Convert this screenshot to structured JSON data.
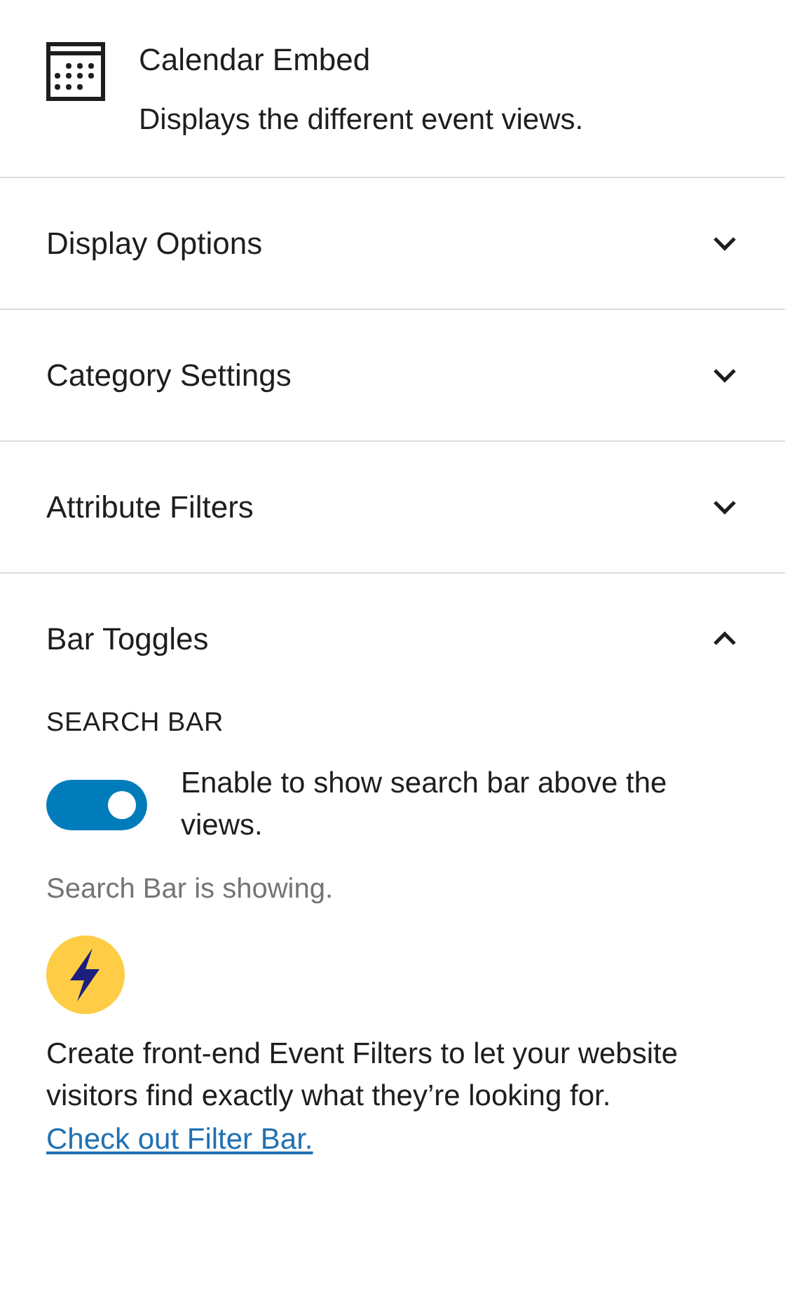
{
  "block": {
    "title": "Calendar Embed",
    "description": "Displays the different event views."
  },
  "panels": [
    {
      "title": "Display Options",
      "expanded": false
    },
    {
      "title": "Category Settings",
      "expanded": false
    },
    {
      "title": "Attribute Filters",
      "expanded": false
    },
    {
      "title": "Bar Toggles",
      "expanded": true,
      "section_label": "SEARCH BAR",
      "toggle": {
        "label": "Enable to show search bar above the views.",
        "on": true
      },
      "help": "Search Bar is showing.",
      "promo": {
        "text": "Create front-end Event Filters to let your website visitors find exactly what they’re looking for.",
        "link": "Check out Filter Bar."
      }
    }
  ]
}
